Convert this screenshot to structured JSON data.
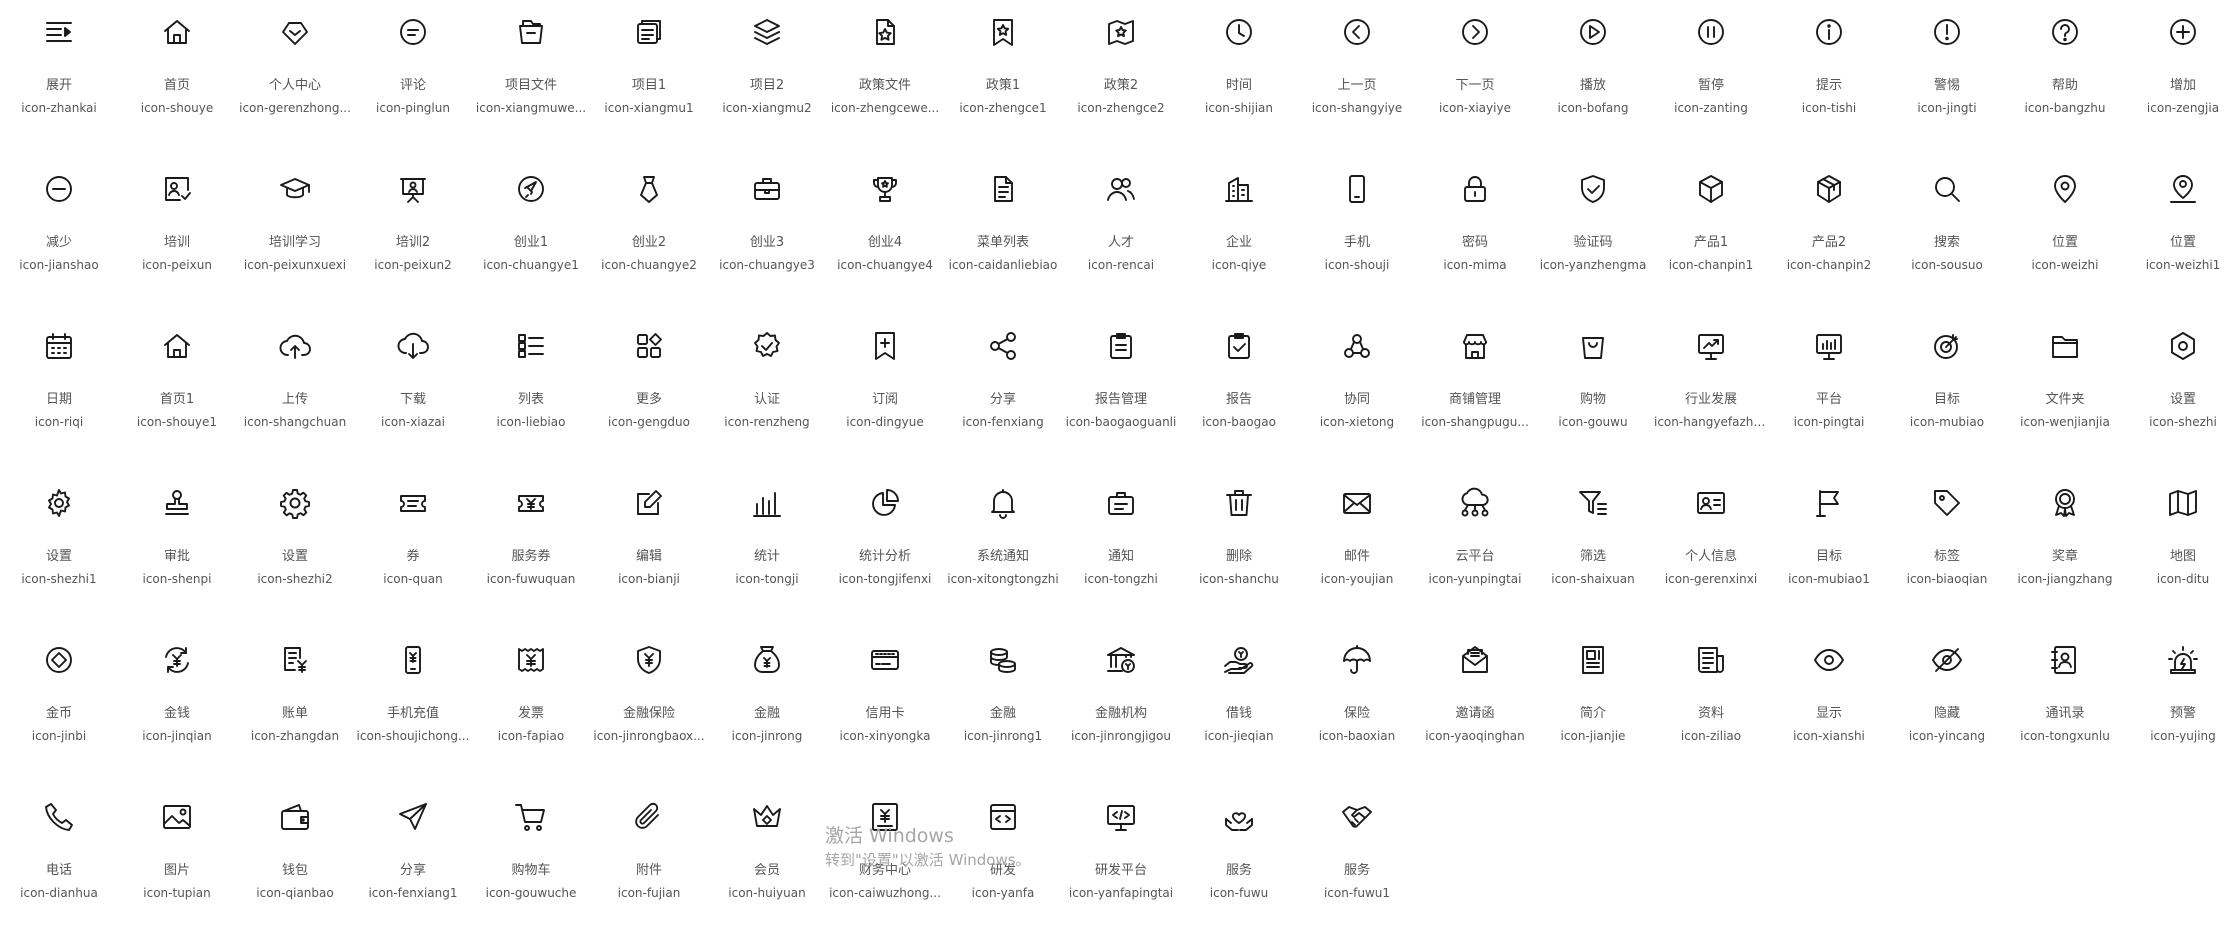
{
  "icons": [
    {
      "label": "展开",
      "code": "icon-zhankai",
      "icon": "menu-unfold-icon"
    },
    {
      "label": "首页",
      "code": "icon-shouye",
      "icon": "home-icon"
    },
    {
      "label": "个人中心",
      "code": "icon-gerenzhong...",
      "icon": "user-center-icon"
    },
    {
      "label": "评论",
      "code": "icon-pinglun",
      "icon": "comment-icon"
    },
    {
      "label": "项目文件",
      "code": "icon-xiangmuwe...",
      "icon": "project-file-icon"
    },
    {
      "label": "项目1",
      "code": "icon-xiangmu1",
      "icon": "project-icon"
    },
    {
      "label": "项目2",
      "code": "icon-xiangmu2",
      "icon": "layers-icon"
    },
    {
      "label": "政策文件",
      "code": "icon-zhengcewe...",
      "icon": "policy-file-icon"
    },
    {
      "label": "政策1",
      "code": "icon-zhengce1",
      "icon": "policy-badge-icon"
    },
    {
      "label": "政策2",
      "code": "icon-zhengce2",
      "icon": "policy-map-icon"
    },
    {
      "label": "时间",
      "code": "icon-shijian",
      "icon": "clock-icon"
    },
    {
      "label": "上一页",
      "code": "icon-shangyiye",
      "icon": "chevron-left-circle-icon"
    },
    {
      "label": "下一页",
      "code": "icon-xiayiye",
      "icon": "chevron-right-circle-icon"
    },
    {
      "label": "播放",
      "code": "icon-bofang",
      "icon": "play-icon"
    },
    {
      "label": "暂停",
      "code": "icon-zanting",
      "icon": "pause-icon"
    },
    {
      "label": "提示",
      "code": "icon-tishi",
      "icon": "info-icon"
    },
    {
      "label": "警惕",
      "code": "icon-jingti",
      "icon": "alert-icon"
    },
    {
      "label": "帮助",
      "code": "icon-bangzhu",
      "icon": "help-icon"
    },
    {
      "label": "增加",
      "code": "icon-zengjia",
      "icon": "plus-circle-icon"
    },
    {
      "label": "减少",
      "code": "icon-jianshao",
      "icon": "minus-circle-icon"
    },
    {
      "label": "培训",
      "code": "icon-peixun",
      "icon": "training-board-icon"
    },
    {
      "label": "培训学习",
      "code": "icon-peixunxuexi",
      "icon": "graduation-cap-icon"
    },
    {
      "label": "培训2",
      "code": "icon-peixun2",
      "icon": "presentation-icon"
    },
    {
      "label": "创业1",
      "code": "icon-chuangye1",
      "icon": "rocket-circle-icon"
    },
    {
      "label": "创业2",
      "code": "icon-chuangye2",
      "icon": "tie-icon"
    },
    {
      "label": "创业3",
      "code": "icon-chuangye3",
      "icon": "briefcase-icon"
    },
    {
      "label": "创业4",
      "code": "icon-chuangye4",
      "icon": "trophy-icon"
    },
    {
      "label": "菜单列表",
      "code": "icon-caidanliebiao",
      "icon": "document-list-icon"
    },
    {
      "label": "人才",
      "code": "icon-rencai",
      "icon": "users-icon"
    },
    {
      "label": "企业",
      "code": "icon-qiye",
      "icon": "building-icon"
    },
    {
      "label": "手机",
      "code": "icon-shouji",
      "icon": "mobile-icon"
    },
    {
      "label": "密码",
      "code": "icon-mima",
      "icon": "lock-icon"
    },
    {
      "label": "验证码",
      "code": "icon-yanzhengma",
      "icon": "shield-check-icon"
    },
    {
      "label": "产品1",
      "code": "icon-chanpin1",
      "icon": "cube-icon"
    },
    {
      "label": "产品2",
      "code": "icon-chanpin2",
      "icon": "box-icon"
    },
    {
      "label": "搜索",
      "code": "icon-sousuo",
      "icon": "search-icon"
    },
    {
      "label": "位置",
      "code": "icon-weizhi",
      "icon": "location-pin-icon"
    },
    {
      "label": "位置",
      "code": "icon-weizhi1",
      "icon": "location-person-icon"
    },
    {
      "label": "日期",
      "code": "icon-riqi",
      "icon": "calendar-icon"
    },
    {
      "label": "首页1",
      "code": "icon-shouye1",
      "icon": "home-outline-icon"
    },
    {
      "label": "上传",
      "code": "icon-shangchuan",
      "icon": "cloud-upload-icon"
    },
    {
      "label": "下载",
      "code": "icon-xiazai",
      "icon": "cloud-download-icon"
    },
    {
      "label": "列表",
      "code": "icon-liebiao",
      "icon": "list-icon"
    },
    {
      "label": "更多",
      "code": "icon-gengduo",
      "icon": "grid-more-icon"
    },
    {
      "label": "认证",
      "code": "icon-renzheng",
      "icon": "verified-badge-icon"
    },
    {
      "label": "订阅",
      "code": "icon-dingyue",
      "icon": "bookmark-plus-icon"
    },
    {
      "label": "分享",
      "code": "icon-fenxiang",
      "icon": "share-icon"
    },
    {
      "label": "报告管理",
      "code": "icon-baogaoguanli",
      "icon": "clipboard-list-icon"
    },
    {
      "label": "报告",
      "code": "icon-baogao",
      "icon": "clipboard-check-icon"
    },
    {
      "label": "协同",
      "code": "icon-xietong",
      "icon": "collaboration-icon"
    },
    {
      "label": "商铺管理",
      "code": "icon-shangpugu...",
      "icon": "store-icon"
    },
    {
      "label": "购物",
      "code": "icon-gouwu",
      "icon": "shopping-bag-icon"
    },
    {
      "label": "行业发展",
      "code": "icon-hangyefazhan",
      "icon": "trend-monitor-icon"
    },
    {
      "label": "平台",
      "code": "icon-pingtai",
      "icon": "bar-monitor-icon"
    },
    {
      "label": "目标",
      "code": "icon-mubiao",
      "icon": "target-icon"
    },
    {
      "label": "文件夹",
      "code": "icon-wenjianjia",
      "icon": "folder-icon"
    },
    {
      "label": "设置",
      "code": "icon-shezhi",
      "icon": "hexagon-settings-icon"
    },
    {
      "label": "设置",
      "code": "icon-shezhi1",
      "icon": "gear-icon"
    },
    {
      "label": "审批",
      "code": "icon-shenpi",
      "icon": "stamp-icon"
    },
    {
      "label": "设置",
      "code": "icon-shezhi2",
      "icon": "gear-outline-icon"
    },
    {
      "label": "券",
      "code": "icon-quan",
      "icon": "ticket-icon"
    },
    {
      "label": "服务券",
      "code": "icon-fuwuquan",
      "icon": "yen-ticket-icon"
    },
    {
      "label": "编辑",
      "code": "icon-bianji",
      "icon": "edit-icon"
    },
    {
      "label": "统计",
      "code": "icon-tongji",
      "icon": "bar-chart-icon"
    },
    {
      "label": "统计分析",
      "code": "icon-tongjifenxi",
      "icon": "pie-chart-icon"
    },
    {
      "label": "系统通知",
      "code": "icon-xitongtongzhi",
      "icon": "bell-icon"
    },
    {
      "label": "通知",
      "code": "icon-tongzhi",
      "icon": "notice-board-icon"
    },
    {
      "label": "删除",
      "code": "icon-shanchu",
      "icon": "trash-icon"
    },
    {
      "label": "邮件",
      "code": "icon-youjian",
      "icon": "mail-icon"
    },
    {
      "label": "云平台",
      "code": "icon-yunpingtai",
      "icon": "cloud-network-icon"
    },
    {
      "label": "筛选",
      "code": "icon-shaixuan",
      "icon": "filter-icon"
    },
    {
      "label": "个人信息",
      "code": "icon-gerenxinxi",
      "icon": "id-card-icon"
    },
    {
      "label": "目标",
      "code": "icon-mubiao1",
      "icon": "flag-icon"
    },
    {
      "label": "标签",
      "code": "icon-biaoqian",
      "icon": "tag-icon"
    },
    {
      "label": "奖章",
      "code": "icon-jiangzhang",
      "icon": "medal-icon"
    },
    {
      "label": "地图",
      "code": "icon-ditu",
      "icon": "map-icon"
    },
    {
      "label": "金币",
      "code": "icon-jinbi",
      "icon": "coin-icon"
    },
    {
      "label": "金钱",
      "code": "icon-jinqian",
      "icon": "money-cycle-icon"
    },
    {
      "label": "账单",
      "code": "icon-zhangdan",
      "icon": "bill-icon"
    },
    {
      "label": "手机充值",
      "code": "icon-shoujichong...",
      "icon": "mobile-recharge-icon"
    },
    {
      "label": "发票",
      "code": "icon-fapiao",
      "icon": "invoice-icon"
    },
    {
      "label": "金融保险",
      "code": "icon-jinrongbaox...",
      "icon": "finance-shield-icon"
    },
    {
      "label": "金融",
      "code": "icon-jinrong",
      "icon": "money-bag-icon"
    },
    {
      "label": "信用卡",
      "code": "icon-xinyongka",
      "icon": "credit-card-icon"
    },
    {
      "label": "金融",
      "code": "icon-jinrong1",
      "icon": "coins-stack-icon"
    },
    {
      "label": "金融机构",
      "code": "icon-jinrongjigou",
      "icon": "bank-icon"
    },
    {
      "label": "借钱",
      "code": "icon-jieqian",
      "icon": "hand-coin-icon"
    },
    {
      "label": "保险",
      "code": "icon-baoxian",
      "icon": "umbrella-icon"
    },
    {
      "label": "邀请函",
      "code": "icon-yaoqinghan",
      "icon": "invitation-icon"
    },
    {
      "label": "简介",
      "code": "icon-jianjie",
      "icon": "profile-doc-icon"
    },
    {
      "label": "资料",
      "code": "icon-ziliao",
      "icon": "newspaper-icon"
    },
    {
      "label": "显示",
      "code": "icon-xianshi",
      "icon": "eye-icon"
    },
    {
      "label": "隐藏",
      "code": "icon-yincang",
      "icon": "eye-off-icon"
    },
    {
      "label": "通讯录",
      "code": "icon-tongxunlu",
      "icon": "contacts-icon"
    },
    {
      "label": "预警",
      "code": "icon-yujing",
      "icon": "siren-icon"
    },
    {
      "label": "电话",
      "code": "icon-dianhua",
      "icon": "phone-icon"
    },
    {
      "label": "图片",
      "code": "icon-tupian",
      "icon": "image-icon"
    },
    {
      "label": "钱包",
      "code": "icon-qianbao",
      "icon": "wallet-icon"
    },
    {
      "label": "分享",
      "code": "icon-fenxiang1",
      "icon": "send-icon"
    },
    {
      "label": "购物车",
      "code": "icon-gouwuche",
      "icon": "cart-icon"
    },
    {
      "label": "附件",
      "code": "icon-fujian",
      "icon": "paperclip-icon"
    },
    {
      "label": "会员",
      "code": "icon-huiyuan",
      "icon": "crown-icon"
    },
    {
      "label": "财务中心",
      "code": "icon-caiwuzhong...",
      "icon": "finance-center-icon"
    },
    {
      "label": "研发",
      "code": "icon-yanfa",
      "icon": "code-window-icon"
    },
    {
      "label": "研发平台",
      "code": "icon-yanfapingtai",
      "icon": "code-monitor-icon"
    },
    {
      "label": "服务",
      "code": "icon-fuwu",
      "icon": "heart-hands-icon"
    },
    {
      "label": "服务",
      "code": "icon-fuwu1",
      "icon": "handshake-icon"
    }
  ],
  "watermark": {
    "title": "激活 Windows",
    "subtitle": "转到\"设置\"以激活 Windows。"
  }
}
